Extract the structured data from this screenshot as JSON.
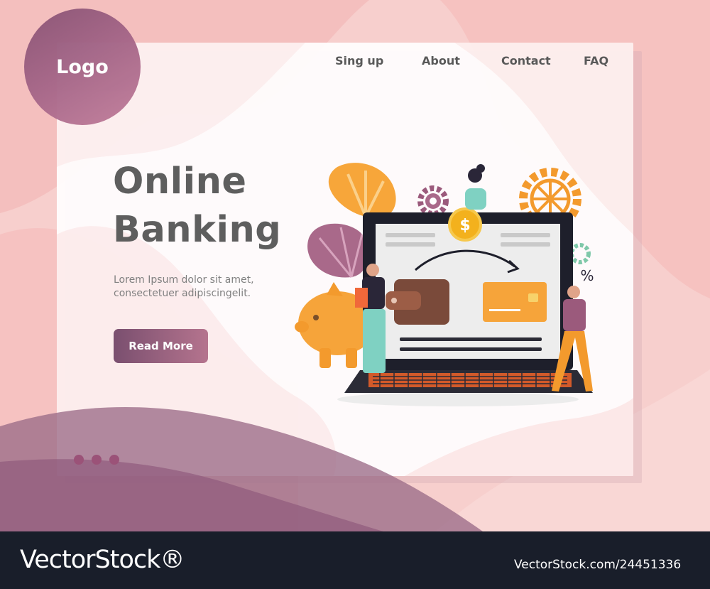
{
  "logo": {
    "label": "Logo"
  },
  "nav": {
    "signup": "Sing up",
    "about": "About",
    "contact": "Contact",
    "faq": "FAQ"
  },
  "hero": {
    "title_line1": "Online",
    "title_line2": "Banking",
    "desc_line1": "Lorem Ipsum dolor sit amet,",
    "desc_line2": "consectetuer adipiscingelit.",
    "button_label": "Read More"
  },
  "slider": {
    "dots": 3
  },
  "illustration": {
    "percent_sign": "%"
  },
  "watermark": {
    "brand": "VectorStock®",
    "image_id": "VectorStock.com/24451336"
  },
  "colors": {
    "accent_purple": "#8a5475",
    "button_start": "#7a4f6f",
    "button_end": "#b5748e",
    "text_gray": "#5e5e5e",
    "orange": "#f39a2d",
    "footer": "#191e2a"
  }
}
